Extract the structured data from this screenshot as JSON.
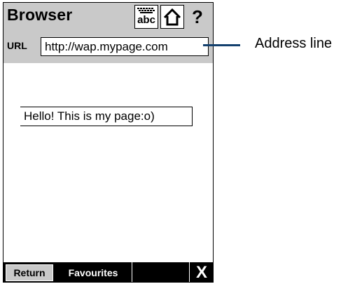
{
  "app": {
    "title": "Browser",
    "icons": {
      "keyboard": "keyboard-abc-icon",
      "home": "home-icon",
      "help": "help-icon"
    },
    "help_label": "?",
    "keyboard_label": "abc"
  },
  "url_bar": {
    "label": "URL",
    "value": "http://wap.mypage.com"
  },
  "content": {
    "text": "Hello! This is my page:o)"
  },
  "softkeys": {
    "return_label": "Return",
    "favourites_label": "Favourites",
    "close_label": "X"
  },
  "annotation": {
    "label": "Address line",
    "color": "#13406e"
  },
  "colors": {
    "bar_gray": "#c9c9c9",
    "softkey_bar": "#000000"
  }
}
